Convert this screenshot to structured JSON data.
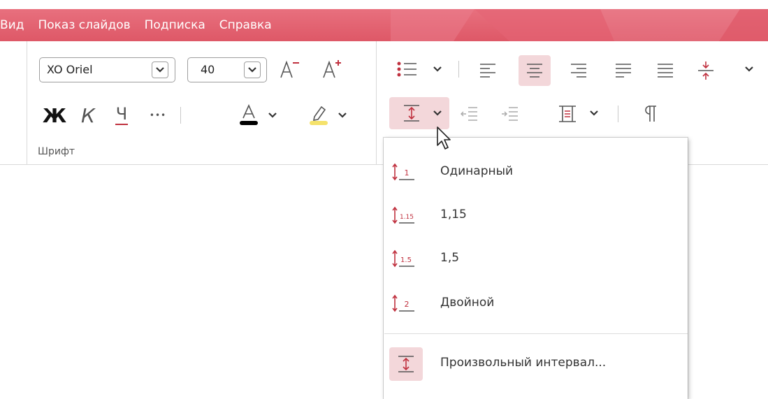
{
  "menu": {
    "items": [
      "Вид",
      "Показ слайдов",
      "Подписка",
      "Справка"
    ]
  },
  "font_group": {
    "font_name": "XO Oriel",
    "font_size": "40",
    "decrease_size_icon": "A-minus",
    "increase_size_icon": "A-plus",
    "bold_label": "Ж",
    "italic_label": "К",
    "underline_label": "Ч",
    "more_label": "•••",
    "label": "Шрифт"
  },
  "paragraph_group": {
    "icons": [
      "bullet-list-icon",
      "align-left-icon",
      "align-center-icon",
      "align-right-icon",
      "align-justify-icon",
      "align-distributed-icon",
      "vertical-align-icon",
      "line-spacing-icon",
      "decrease-indent-icon",
      "increase-indent-icon",
      "paragraph-spacing-icon",
      "show-formatting-icon"
    ]
  },
  "line_spacing_menu": {
    "items": [
      {
        "badge": "1",
        "label": "Одинарный"
      },
      {
        "badge": "1.15",
        "label": "1,15"
      },
      {
        "badge": "1.5",
        "label": "1,5"
      },
      {
        "badge": "2",
        "label": "Двойной"
      }
    ],
    "custom_label": "Произвольный интервал..."
  },
  "colors": {
    "accent": "#de5867",
    "icon_red": "#c0313f",
    "selected_bg": "#f3d7da",
    "font_color_bar": "#000000",
    "highlight_bar": "#f5e26b"
  }
}
